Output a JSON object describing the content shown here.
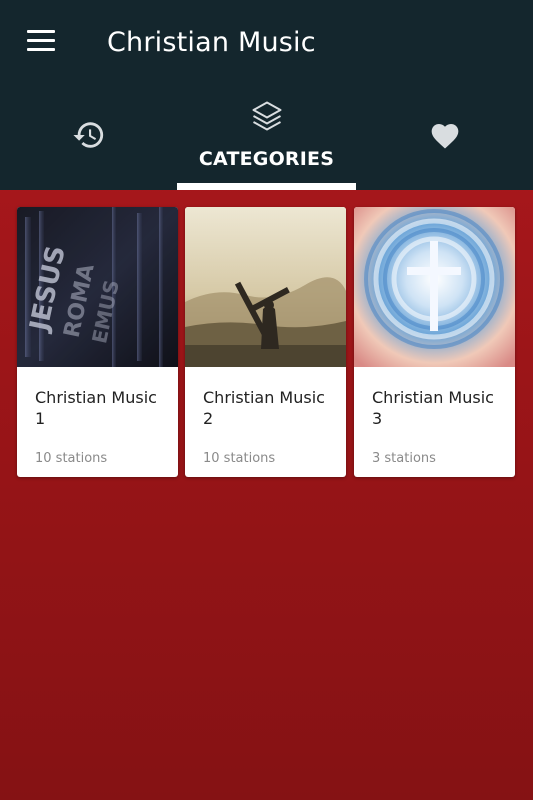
{
  "app": {
    "title": "Christian Music"
  },
  "tabs": {
    "recent": {
      "icon": "history-icon"
    },
    "categories": {
      "label": "CATEGORIES",
      "icon": "layers-icon",
      "selected": true
    },
    "favorites": {
      "icon": "heart-icon"
    }
  },
  "categories": [
    {
      "title": "Christian Music 1",
      "subtitle": "10 stations",
      "image": "jesus-text-wall-image"
    },
    {
      "title": "Christian Music 2",
      "subtitle": "10 stations",
      "image": "cross-bearer-silhouette-image"
    },
    {
      "title": "Christian Music 3",
      "subtitle": "3 stations",
      "image": "cross-in-sky-image"
    }
  ],
  "colors": {
    "topbar": "#14262d",
    "background": "#9c1518",
    "accent": "#ffffff"
  }
}
